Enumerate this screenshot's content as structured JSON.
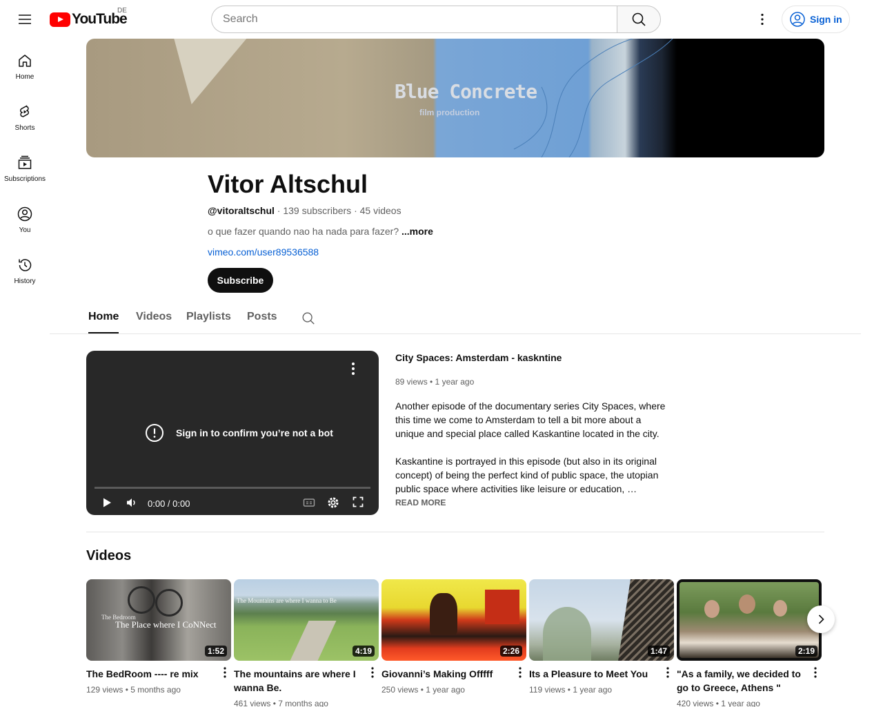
{
  "header": {
    "logo_text": "YouTube",
    "region": "DE",
    "search_placeholder": "Search",
    "signin_label": "Sign in"
  },
  "sidebar": {
    "items": [
      {
        "label": "Home",
        "icon": "home-icon"
      },
      {
        "label": "Shorts",
        "icon": "shorts-icon"
      },
      {
        "label": "Subscriptions",
        "icon": "subscriptions-icon"
      },
      {
        "label": "You",
        "icon": "you-icon"
      },
      {
        "label": "History",
        "icon": "history-icon"
      }
    ]
  },
  "banner": {
    "title": "Blue Concrete",
    "subtitle": "film production"
  },
  "channel": {
    "name": "Vitor Altschul",
    "handle": "@vitoraltschul",
    "subscribers": "139 subscribers",
    "videos_count": "45 videos",
    "separator": " · ",
    "description": "o que fazer quando nao ha nada para fazer?",
    "more_label": "...more",
    "link": "vimeo.com/user89536588",
    "subscribe_label": "Subscribe"
  },
  "tabs": [
    {
      "label": "Home",
      "active": true
    },
    {
      "label": "Videos",
      "active": false
    },
    {
      "label": "Playlists",
      "active": false
    },
    {
      "label": "Posts",
      "active": false
    }
  ],
  "player": {
    "message": "Sign in to confirm you’re not a bot",
    "time": "0:00 / 0:00"
  },
  "featured": {
    "title": "City Spaces: Amsterdam - kaskntine",
    "meta": "89 views • 1 year ago",
    "desc_p1": "Another episode of the documentary series City Spaces, where this time we come to Amsterdam to tell a bit more about a unique and special place called Kaskantine located in the city.",
    "desc_p2": "Kaskantine is portrayed in this episode (but also in its original concept) of being the perfect kind of public space, the utopian public space where activities like leisure or education, …",
    "read_more": "READ MORE"
  },
  "shelf": {
    "title": "Videos",
    "videos": [
      {
        "title": "The BedRoom ---- re mix",
        "meta": "129 views • 5 months ago",
        "duration": "1:52",
        "thumb_text_small": "The Bedroom",
        "thumb_text": "The Place where I CoNNect"
      },
      {
        "title": "The mountains are where I wanna Be.",
        "meta": "461 views • 7 months ago",
        "duration": "4:19",
        "thumb_text": "The Mountains are where I wanna to Be"
      },
      {
        "title": "Giovanni’s Making Offfff",
        "meta": "250 views • 1 year ago",
        "duration": "2:26"
      },
      {
        "title": "Its a Pleasure to Meet You",
        "meta": "119 views • 1 year ago",
        "duration": "1:47"
      },
      {
        "title": "\"As a family, we decided to go to Greece, Athens \"",
        "meta": "420 views • 1 year ago",
        "duration": "2:19"
      }
    ]
  }
}
